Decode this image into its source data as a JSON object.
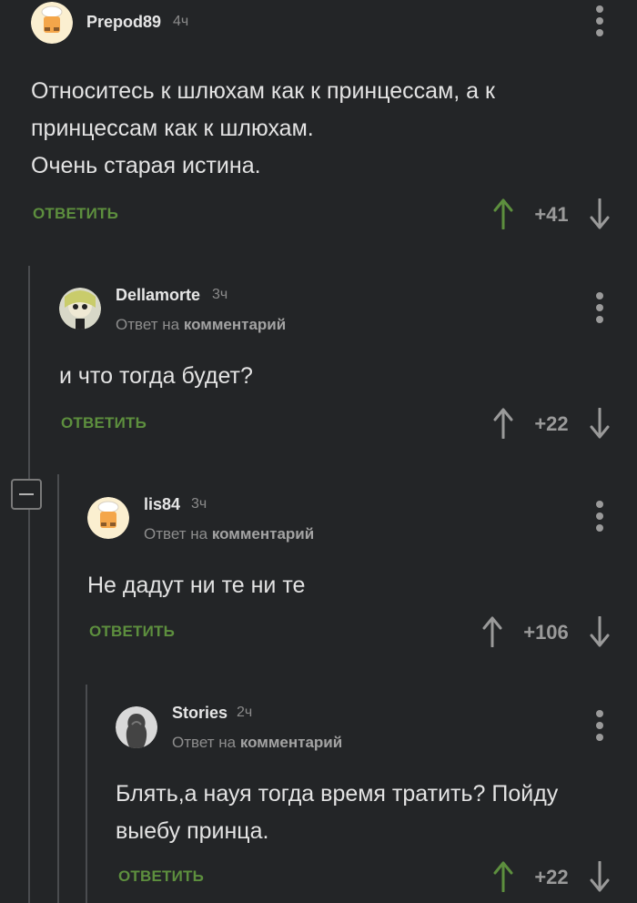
{
  "comments": [
    {
      "user": "Prepod89",
      "time": "4ч",
      "text": "Относитесь к шлюхам как к принцессам, а к\nпринцессам как к шлюхам.\nОчень старая истина.",
      "reply": "ОТВЕТИТЬ",
      "score": "+41",
      "upvoted": true
    },
    {
      "user": "Dellamorte",
      "time": "3ч",
      "reply_to_prefix": "Ответ на",
      "reply_to_link": "комментарий",
      "text": "и что тогда будет?",
      "reply": "ОТВЕТИТЬ",
      "score": "+22",
      "upvoted": false
    },
    {
      "user": "lis84",
      "time": "3ч",
      "reply_to_prefix": "Ответ на",
      "reply_to_link": "комментарий",
      "text": "Не дадут ни те ни те",
      "reply": "ОТВЕТИТЬ",
      "score": "+106",
      "upvoted": false
    },
    {
      "user": "Stories",
      "time": "2ч",
      "reply_to_prefix": "Ответ на",
      "reply_to_link": "комментарий",
      "text": "Блять,а науя тогда время тратить? Пойду\nвыебу принца.",
      "reply": "ОТВЕТИТЬ",
      "score": "+22",
      "upvoted": true
    }
  ],
  "colors": {
    "background": "#232527",
    "reply_green": "#5d8f3e",
    "upvote_green": "#5d8f3e",
    "neutral_arrow": "#9a9a9a"
  },
  "icons": [
    "kebab-menu-icon",
    "upvote-arrow-icon",
    "downvote-arrow-icon",
    "collapse-minus-icon"
  ]
}
